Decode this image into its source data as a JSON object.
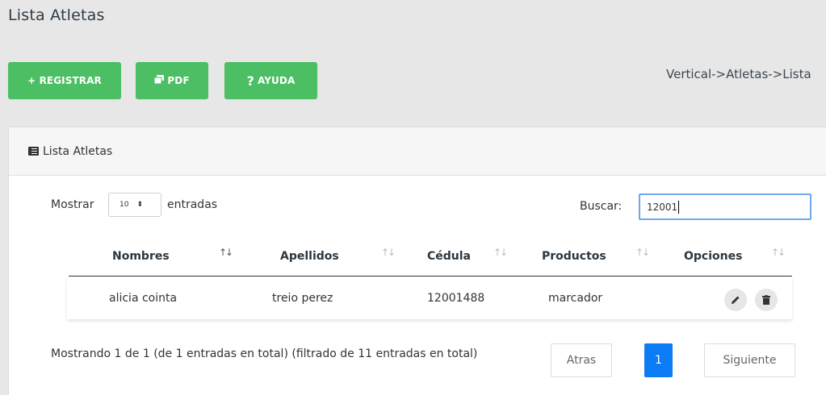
{
  "page": {
    "title": "Lista Atletas"
  },
  "toolbar": {
    "register_label": "+ REGISTRAR",
    "pdf_label": "PDF",
    "help_label": "AYUDA",
    "help_symbol": "?"
  },
  "breadcrumb": "Vertical->Atletas->Lista",
  "panel": {
    "heading": "Lista Atletas"
  },
  "table_controls": {
    "show_label": "Mostrar",
    "page_length": "10",
    "entries_label": "entradas",
    "search_label": "Buscar:",
    "search_value": "12001"
  },
  "table": {
    "columns": [
      "Nombres",
      "Apellidos",
      "Cédula",
      "Productos",
      "Opciones"
    ],
    "rows": [
      {
        "nombres": "alicia cointa",
        "apellidos": "treio perez",
        "cedula": "12001488",
        "productos": "marcador"
      }
    ]
  },
  "footer": {
    "info": "Mostrando 1 de 1 (de 1 entradas en total) (filtrado de 11 entradas en total)",
    "prev_label": "Atras",
    "current_page": "1",
    "next_label": "Siguiente"
  },
  "colors": {
    "accent_green": "#4cbe64",
    "page_active": "#0b7cf4"
  }
}
